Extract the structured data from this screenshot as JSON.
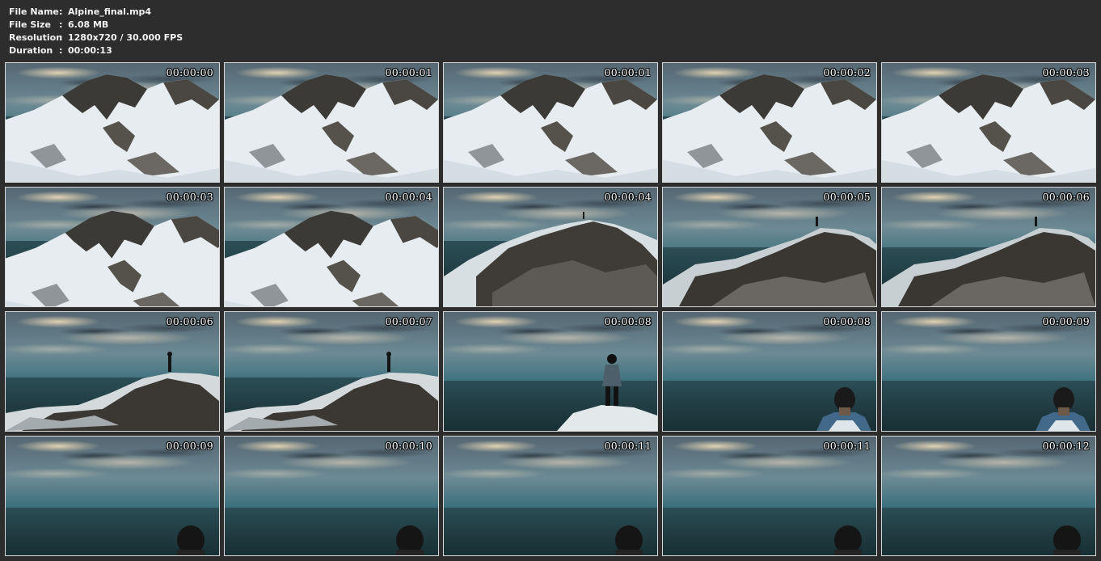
{
  "file_info": [
    {
      "key": "File Name",
      "value": "Alpine_final.mp4"
    },
    {
      "key": "File Size",
      "value": "6.08 MB"
    },
    {
      "key": "Resolution",
      "value": "1280x720 / 30.000 FPS"
    },
    {
      "key": "Duration",
      "value": "00:00:13"
    }
  ],
  "separator": ":",
  "thumbnails": [
    {
      "timestamp": "00:00:00",
      "scene": "mountain-wide"
    },
    {
      "timestamp": "00:00:01",
      "scene": "mountain-wide"
    },
    {
      "timestamp": "00:00:01",
      "scene": "mountain-wide"
    },
    {
      "timestamp": "00:00:02",
      "scene": "mountain-wide"
    },
    {
      "timestamp": "00:00:03",
      "scene": "mountain-wide"
    },
    {
      "timestamp": "00:00:03",
      "scene": "mountain-mid"
    },
    {
      "timestamp": "00:00:04",
      "scene": "mountain-mid"
    },
    {
      "timestamp": "00:00:04",
      "scene": "summit-ridge"
    },
    {
      "timestamp": "00:00:05",
      "scene": "summit-figure"
    },
    {
      "timestamp": "00:00:06",
      "scene": "summit-figure"
    },
    {
      "timestamp": "00:00:06",
      "scene": "figure-peak"
    },
    {
      "timestamp": "00:00:07",
      "scene": "figure-peak"
    },
    {
      "timestamp": "00:00:08",
      "scene": "figure-standing"
    },
    {
      "timestamp": "00:00:08",
      "scene": "head-shoulders"
    },
    {
      "timestamp": "00:00:09",
      "scene": "head-shoulders"
    },
    {
      "timestamp": "00:00:09",
      "scene": "head-bottom"
    },
    {
      "timestamp": "00:00:10",
      "scene": "head-bottom"
    },
    {
      "timestamp": "00:00:11",
      "scene": "head-bottom"
    },
    {
      "timestamp": "00:00:11",
      "scene": "head-bottom"
    },
    {
      "timestamp": "00:00:12",
      "scene": "head-bottom"
    }
  ]
}
